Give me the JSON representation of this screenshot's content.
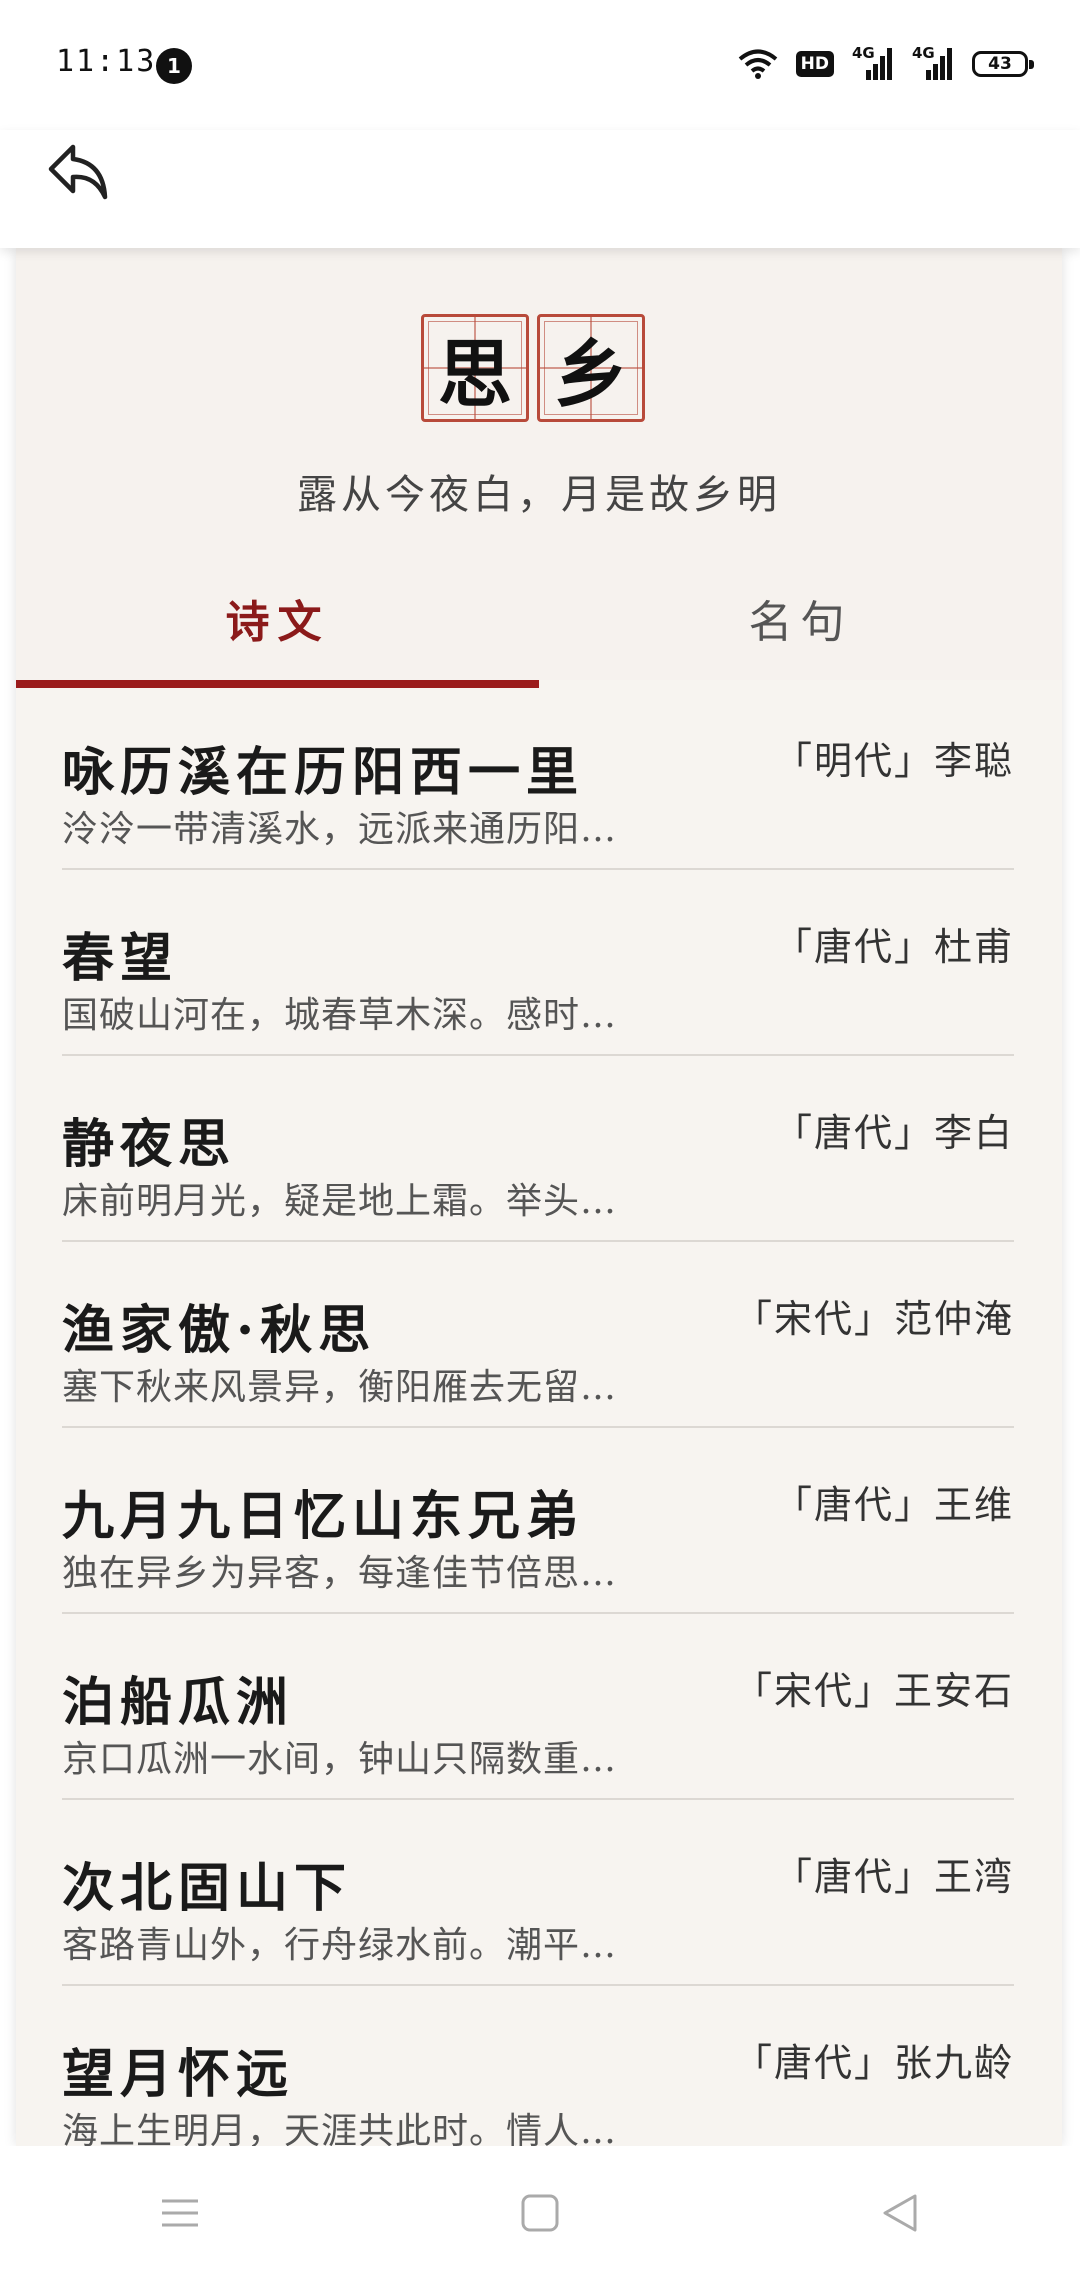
{
  "status_bar": {
    "time": "11:13",
    "notification_count": "1",
    "hd_label": "HD",
    "network_1": "4G",
    "network_2": "4G",
    "battery": "43"
  },
  "header": {
    "seal_chars": [
      "思",
      "乡"
    ],
    "subtitle": "露从今夜白，月是故乡明"
  },
  "tabs": [
    {
      "label": "诗文",
      "active": true
    },
    {
      "label": "名句",
      "active": false
    }
  ],
  "poems": [
    {
      "title": "咏历溪在历阳西一里",
      "author": "「明代」李聪",
      "excerpt": "泠泠一带清溪水，远派来通历阳…"
    },
    {
      "title": "春望",
      "author": "「唐代」杜甫",
      "excerpt": "国破山河在，城春草木深。感时…"
    },
    {
      "title": "静夜思",
      "author": "「唐代」李白",
      "excerpt": "床前明月光，疑是地上霜。举头…"
    },
    {
      "title": "渔家傲·秋思",
      "author": "「宋代」范仲淹",
      "excerpt": "塞下秋来风景异，衡阳雁去无留…"
    },
    {
      "title": "九月九日忆山东兄弟",
      "author": "「唐代」王维",
      "excerpt": "独在异乡为异客，每逢佳节倍思…"
    },
    {
      "title": "泊船瓜洲",
      "author": "「宋代」王安石",
      "excerpt": "京口瓜洲一水间，钟山只隔数重…"
    },
    {
      "title": "次北固山下",
      "author": "「唐代」王湾",
      "excerpt": "客路青山外，行舟绿水前。潮平…"
    },
    {
      "title": "望月怀远",
      "author": "「唐代」张九龄",
      "excerpt": "海上生明月，天涯共此时。情人…"
    }
  ],
  "colors": {
    "accent": "#9b1c1c",
    "seal_border": "#b84a3a",
    "background": "#f7f4f0"
  },
  "icons": {
    "back": "back-arrow-icon",
    "menu": "menu-icon",
    "home": "home-icon",
    "nav_back": "nav-back-icon"
  }
}
